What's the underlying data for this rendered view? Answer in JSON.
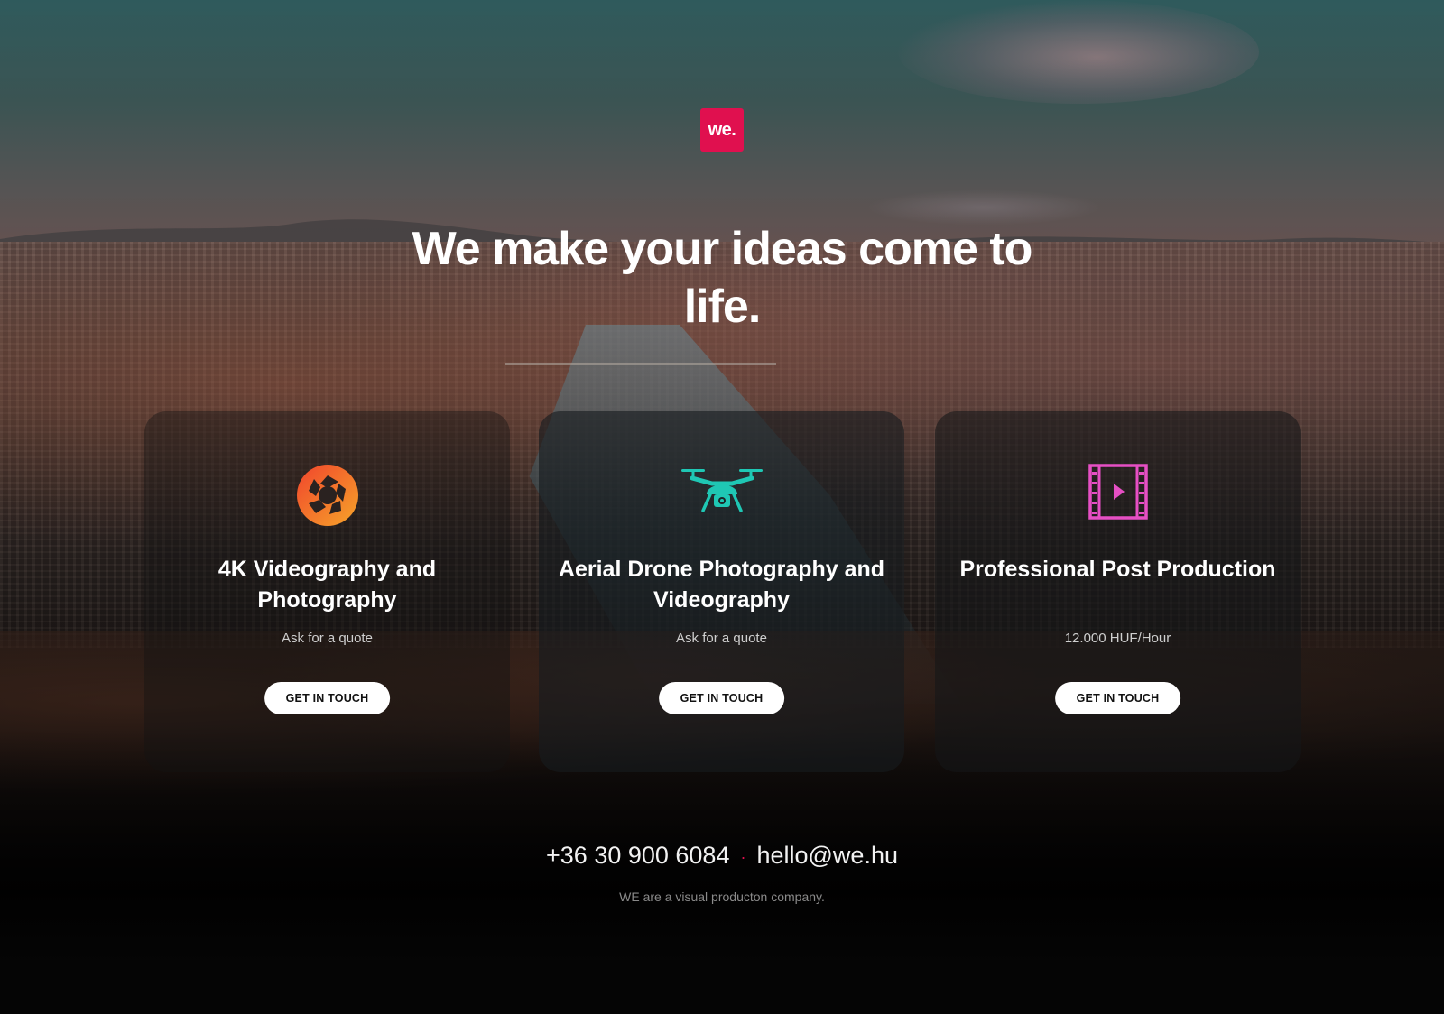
{
  "logo": {
    "text": "we.",
    "color": "#e0104f"
  },
  "hero": {
    "headline": "We make your ideas come to life."
  },
  "services": [
    {
      "icon": "aperture-icon",
      "title": "4K Videography and Photography",
      "subtitle": "Ask for a quote",
      "button": "GET IN TOUCH",
      "icon_color": "#f26b2a"
    },
    {
      "icon": "drone-icon",
      "title": "Aerial Drone Photography and Videography",
      "subtitle": "Ask for a quote",
      "button": "GET IN TOUCH",
      "icon_color": "#1fc7b4"
    },
    {
      "icon": "film-play-icon",
      "title": "Professional Post Production",
      "subtitle": "12.000 HUF/Hour",
      "button": "GET IN TOUCH",
      "icon_color": "#e64fc4"
    }
  ],
  "contact": {
    "phone": "+36 30 900 6084",
    "separator": "·",
    "email": "hello@we.hu"
  },
  "footer": {
    "tagline": "WE are a visual producton company."
  }
}
